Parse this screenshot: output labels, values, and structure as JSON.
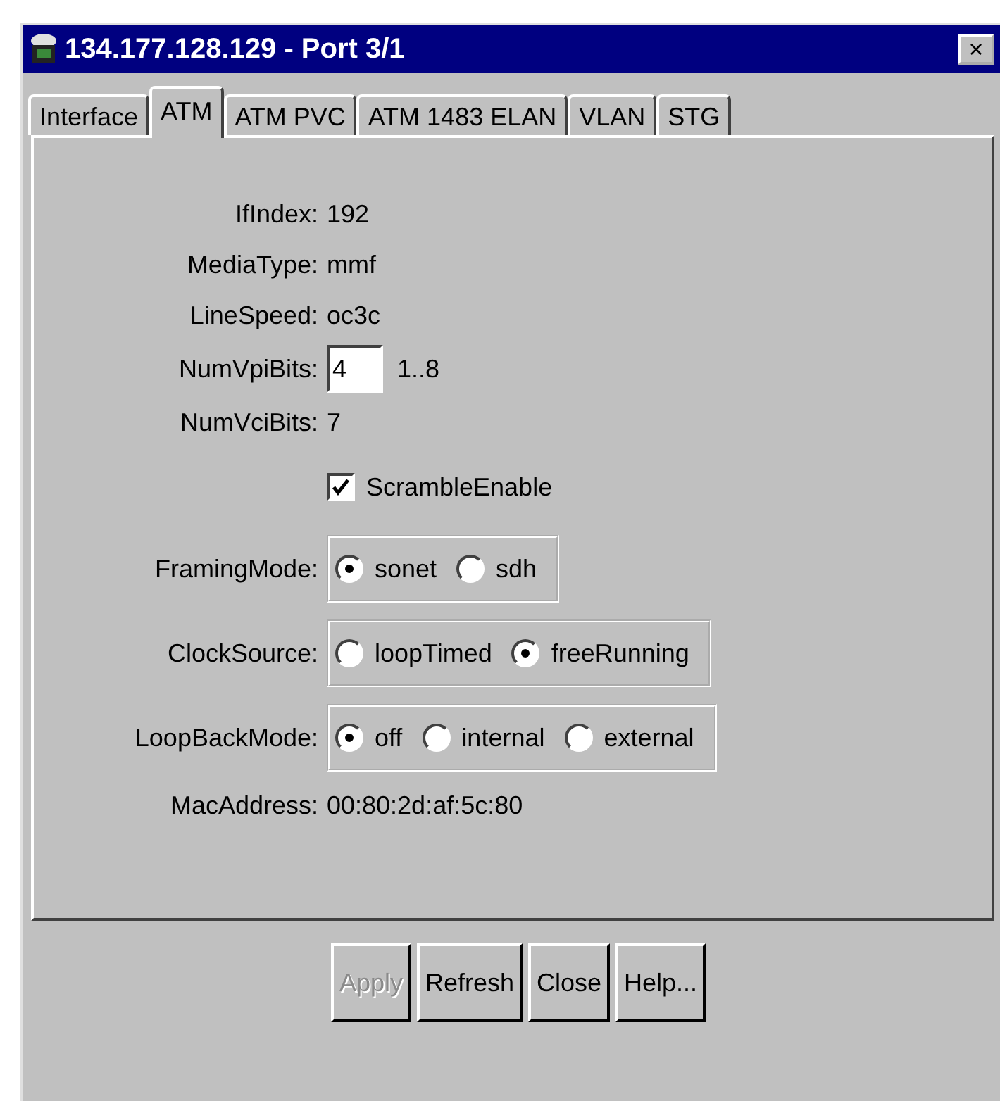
{
  "window": {
    "title": "134.177.128.129 - Port 3/1",
    "close": "×"
  },
  "tabs": [
    {
      "label": "Interface",
      "selected": false
    },
    {
      "label": "ATM",
      "selected": true
    },
    {
      "label": "ATM PVC",
      "selected": false
    },
    {
      "label": "ATM 1483 ELAN",
      "selected": false
    },
    {
      "label": "VLAN",
      "selected": false
    },
    {
      "label": "STG",
      "selected": false
    }
  ],
  "fields": [
    {
      "kind": "text",
      "label": "IfIndex:",
      "value": "192"
    },
    {
      "kind": "text",
      "label": "MediaType:",
      "value": "mmf"
    },
    {
      "kind": "text",
      "label": "LineSpeed:",
      "value": "oc3c"
    },
    {
      "kind": "input",
      "label": "NumVpiBits:",
      "value": "4",
      "hint": "1..8"
    },
    {
      "kind": "text",
      "label": "NumVciBits:",
      "value": "7"
    },
    {
      "kind": "checkbox",
      "text": "ScrambleEnable",
      "checked": true
    },
    {
      "kind": "radio",
      "label": "FramingMode:",
      "options": [
        {
          "label": "sonet",
          "selected": true
        },
        {
          "label": "sdh",
          "selected": false
        }
      ]
    },
    {
      "kind": "radio",
      "label": "ClockSource:",
      "options": [
        {
          "label": "loopTimed",
          "selected": false
        },
        {
          "label": "freeRunning",
          "selected": true
        }
      ]
    },
    {
      "kind": "radio",
      "label": "LoopBackMode:",
      "options": [
        {
          "label": "off",
          "selected": true
        },
        {
          "label": "internal",
          "selected": false
        },
        {
          "label": "external",
          "selected": false
        }
      ]
    },
    {
      "kind": "text",
      "label": "MacAddress:",
      "value": "00:80:2d:af:5c:80"
    }
  ],
  "buttons": [
    {
      "label": "Apply",
      "disabled": true
    },
    {
      "label": "Refresh",
      "disabled": false
    },
    {
      "label": "Close",
      "disabled": false
    },
    {
      "label": "Help...",
      "disabled": false
    }
  ]
}
